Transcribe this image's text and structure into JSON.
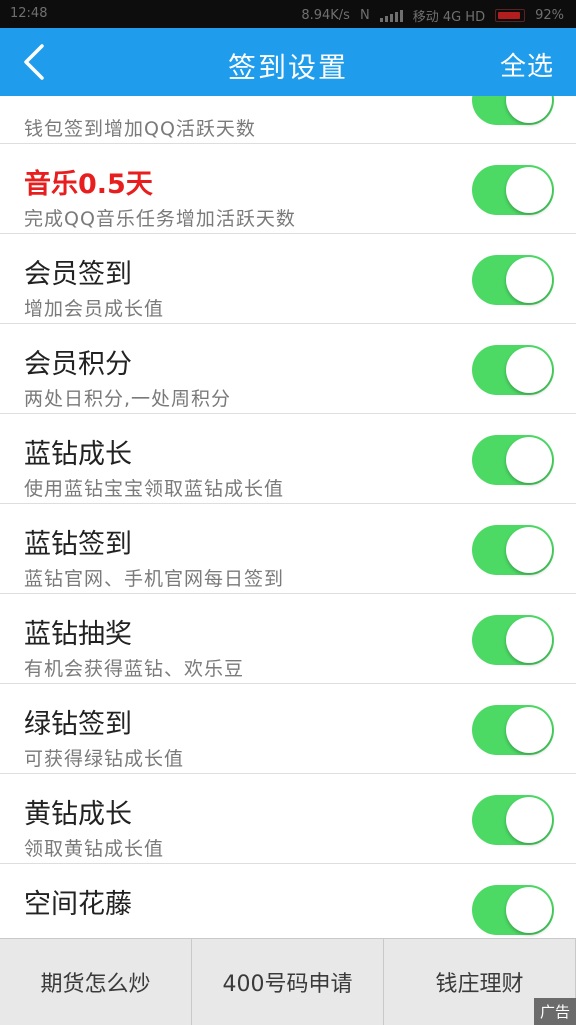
{
  "status_bar": {
    "time": "12:48",
    "speed": "8.94K/s",
    "network": "N",
    "carrier": "移动 4G HD",
    "battery": "92%",
    "battery_level": 0.92
  },
  "header": {
    "title": "签到设置",
    "select_all": "全选",
    "back_icon": "chevron-left-icon",
    "background_color": "#1f9cec"
  },
  "items": [
    {
      "title": "",
      "description": "钱包签到增加QQ活跃天数",
      "enabled": true
    },
    {
      "title": "音乐0.5天",
      "description": "完成QQ音乐任务增加活跃天数",
      "enabled": true,
      "title_color": "#e81e1e"
    },
    {
      "title": "会员签到",
      "description": "增加会员成长值",
      "enabled": true
    },
    {
      "title": "会员积分",
      "description": "两处日积分,一处周积分",
      "enabled": true
    },
    {
      "title": "蓝钻成长",
      "description": "使用蓝钻宝宝领取蓝钻成长值",
      "enabled": true
    },
    {
      "title": "蓝钻签到",
      "description": "蓝钻官网、手机官网每日签到",
      "enabled": true
    },
    {
      "title": "蓝钻抽奖",
      "description": "有机会获得蓝钻、欢乐豆",
      "enabled": true
    },
    {
      "title": "绿钻签到",
      "description": "可获得绿钻成长值",
      "enabled": true
    },
    {
      "title": "黄钻成长",
      "description": "领取黄钻成长值",
      "enabled": true
    },
    {
      "title": "空间花藤",
      "description": "",
      "enabled": true
    }
  ],
  "toggle_on_color": "#4cd964",
  "ad_bar": {
    "items": [
      "期货怎么炒",
      "400号码申请",
      "钱庄理财"
    ],
    "badge": "广告"
  }
}
